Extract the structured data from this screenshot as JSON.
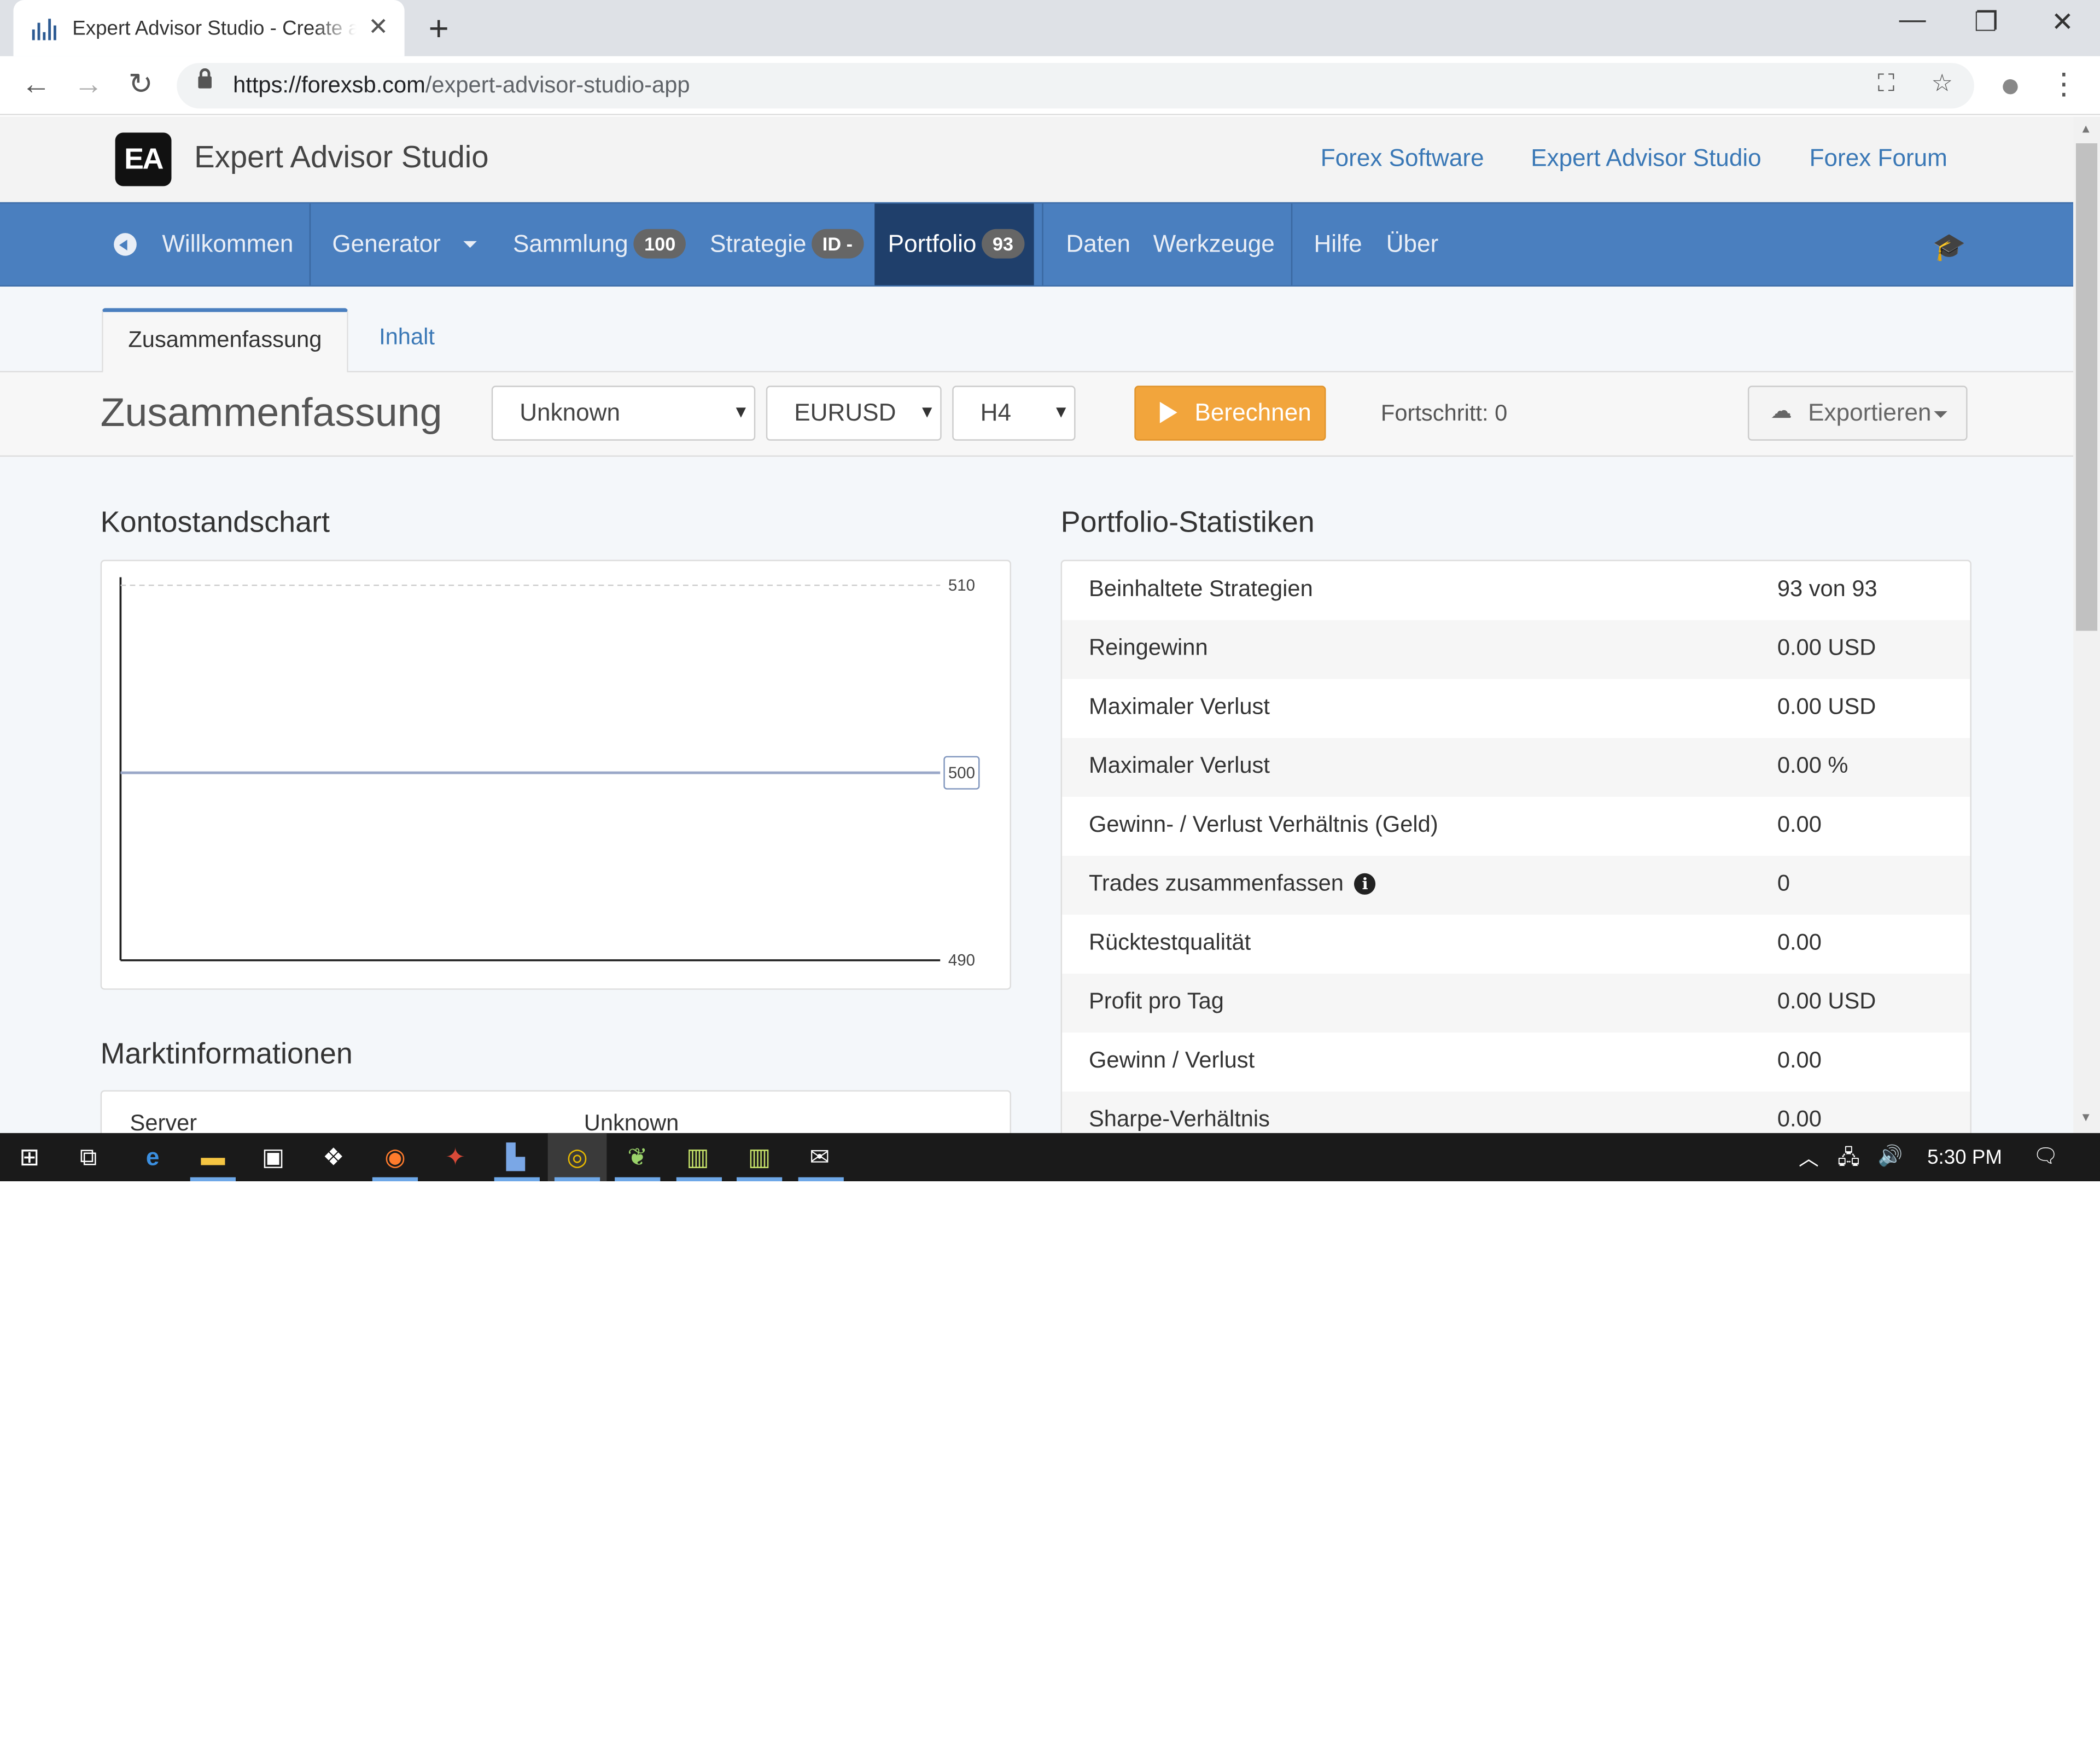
{
  "browser": {
    "tab_title": "Expert Advisor Studio - Create an",
    "url_host": "https://forexsb.com",
    "url_path": "/expert-advisor-studio-app"
  },
  "site": {
    "logo_text": "EA",
    "brand": "Expert Advisor Studio",
    "top_links": [
      "Forex Software",
      "Expert Advisor Studio",
      "Forex Forum"
    ]
  },
  "nav": {
    "welcome": "Willkommen",
    "generator": "Generator",
    "collection": "Sammlung",
    "collection_count": "100",
    "strategy": "Strategie",
    "strategy_badge": "ID -",
    "portfolio": "Portfolio",
    "portfolio_count": "93",
    "data": "Daten",
    "tools": "Werkzeuge",
    "help": "Hilfe",
    "about": "Über"
  },
  "subtabs": {
    "summary": "Zusammenfassung",
    "content": "Inhalt"
  },
  "toolbar": {
    "title": "Zusammenfassung",
    "server_select": "Unknown",
    "symbol_select": "EURUSD",
    "period_select": "H4",
    "calculate": "Berechnen",
    "progress": "Fortschritt: 0",
    "export": "Exportieren"
  },
  "sections": {
    "balance_chart": "Kontostandschart",
    "market_info": "Marktinformationen",
    "portfolio_stats": "Portfolio-Statistiken"
  },
  "chart_data": {
    "type": "line",
    "series": [
      {
        "values": [
          500,
          500
        ]
      }
    ],
    "ylim": [
      490,
      510
    ],
    "yticks": [
      "510",
      "500",
      "490"
    ],
    "current_label": "500"
  },
  "market_info": [
    {
      "label": "Server",
      "value": "Unknown"
    }
  ],
  "stats": [
    {
      "label": "Beinhaltete Strategien",
      "value": "93 von 93"
    },
    {
      "label": "Reingewinn",
      "value": "0.00 USD"
    },
    {
      "label": "Maximaler Verlust",
      "value": "0.00 USD"
    },
    {
      "label": "Maximaler Verlust",
      "value": "0.00 %"
    },
    {
      "label": "Gewinn- / Verlust Verhältnis (Geld)",
      "value": "0.00"
    },
    {
      "label": "Trades zusammenfassen",
      "value": "0"
    },
    {
      "label": "Rücktestqualität",
      "value": "0.00"
    },
    {
      "label": "Profit pro Tag",
      "value": "0.00 USD"
    },
    {
      "label": "Gewinn / Verlust",
      "value": "0.00"
    },
    {
      "label": "Sharpe-Verhältnis",
      "value": "0.00"
    }
  ],
  "taskbar": {
    "time": "5:30 PM"
  },
  "colors": {
    "nav_bg": "#4a7fbf",
    "nav_active": "#1f3f6b",
    "link": "#3a78b6",
    "calc_button": "#f2a53c"
  }
}
